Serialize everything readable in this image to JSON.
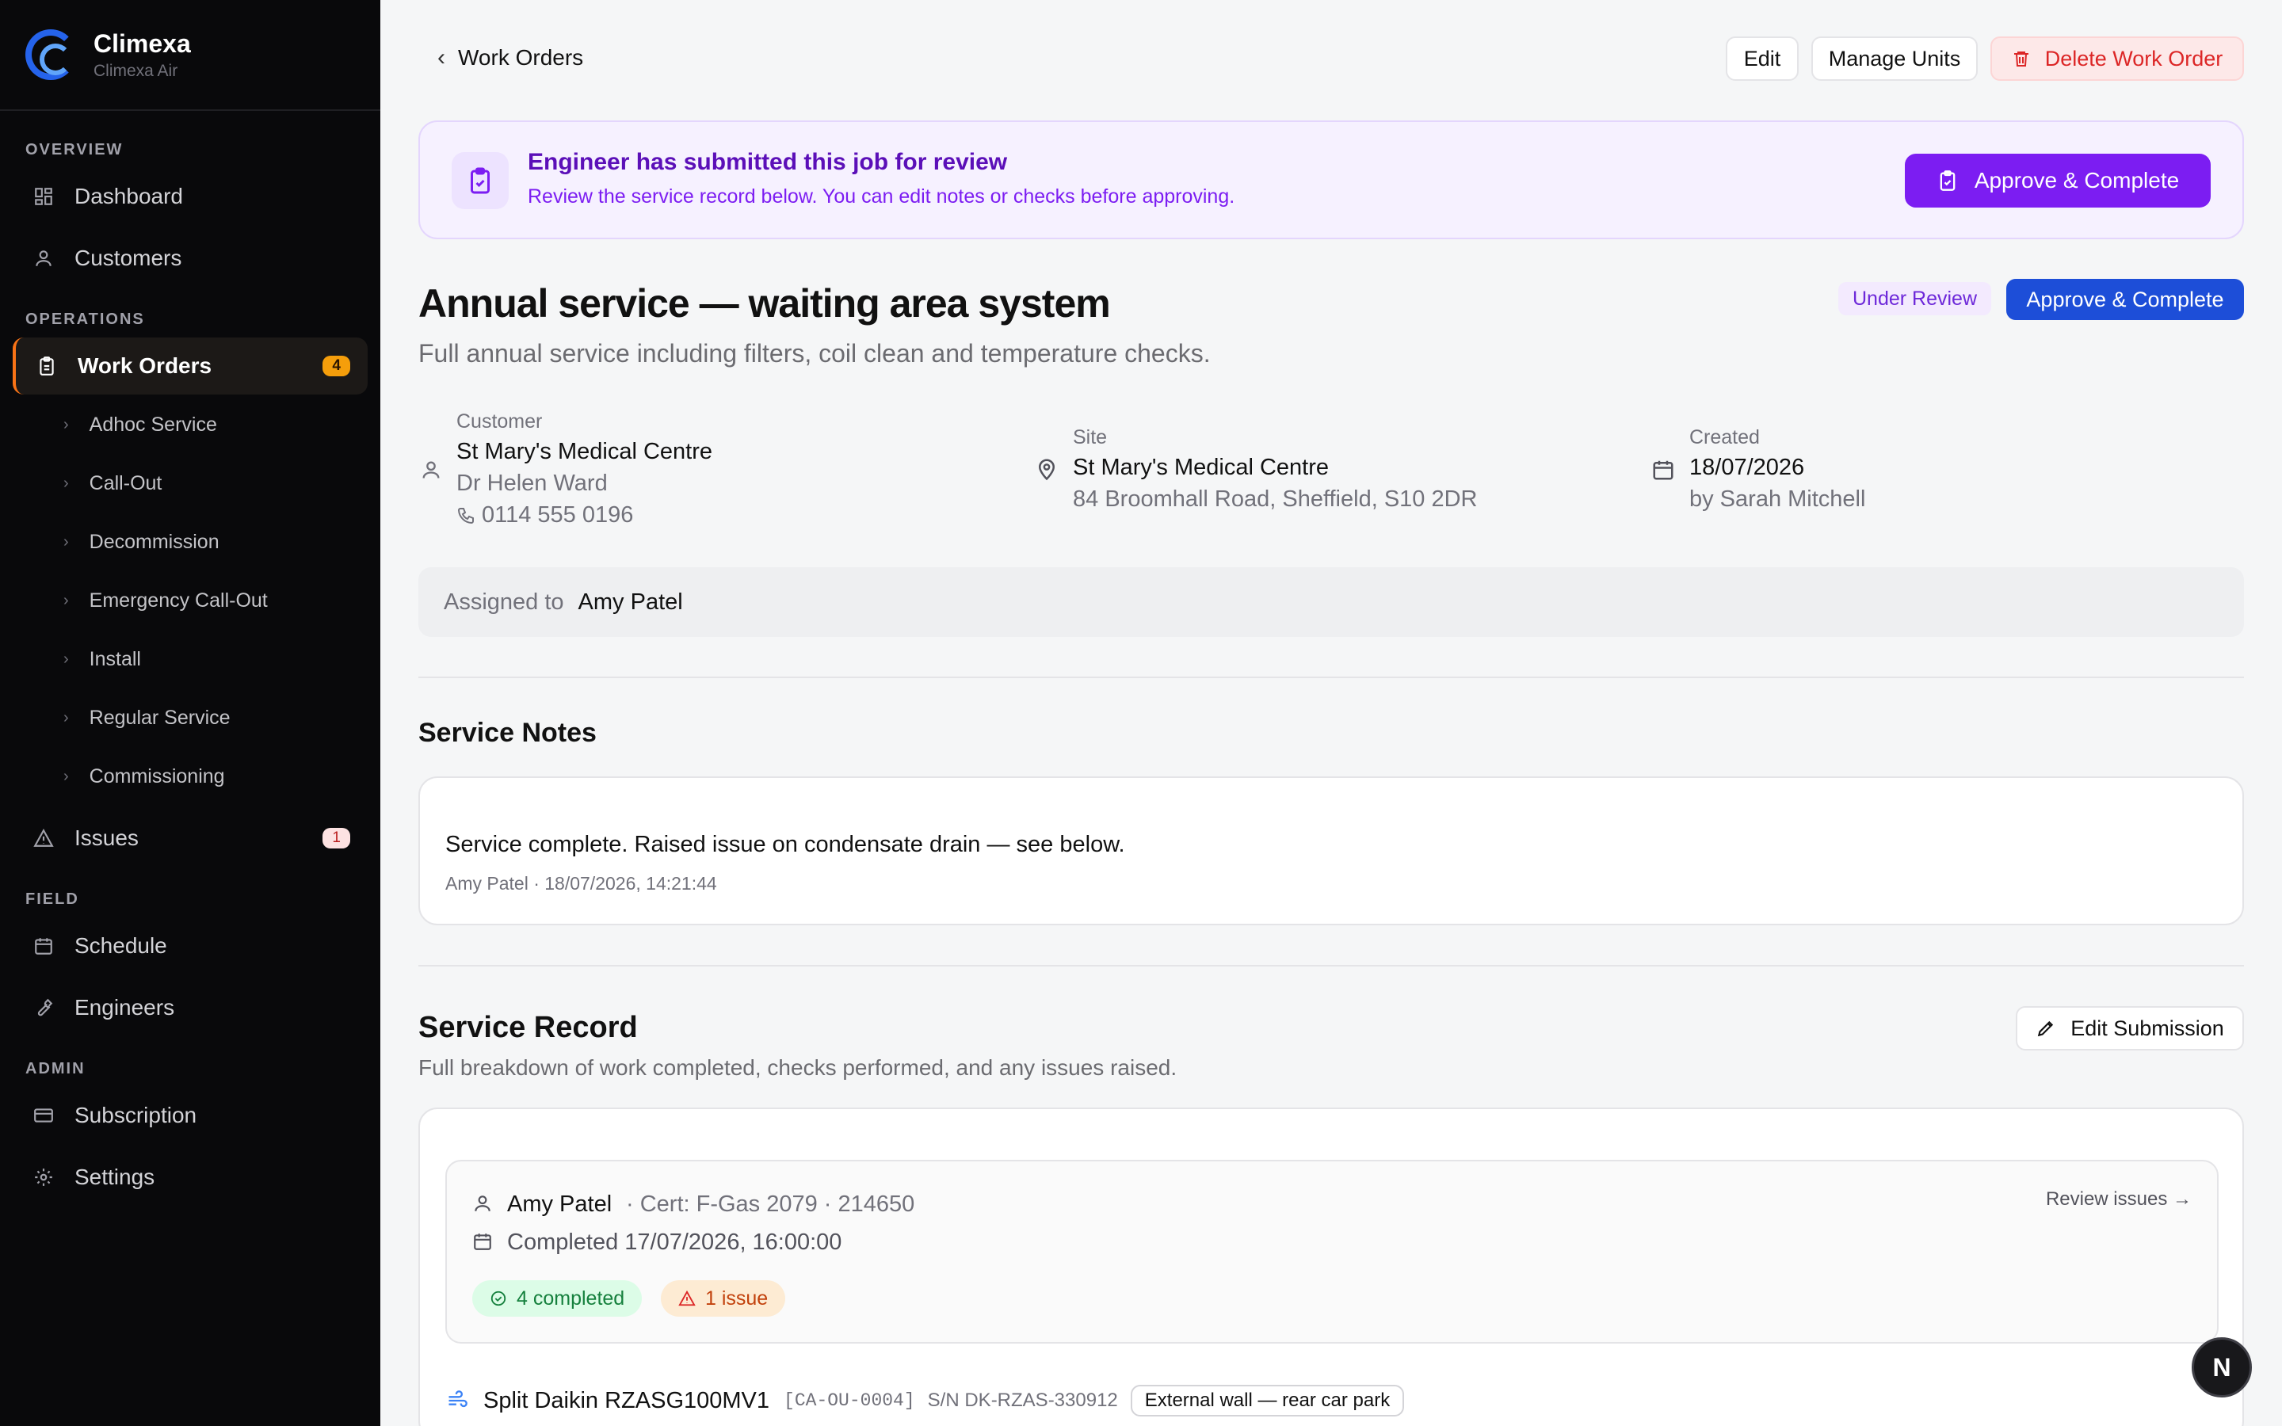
{
  "brand": {
    "name": "Climexa",
    "sub": "Climexa Air"
  },
  "sidebar": {
    "sections": {
      "overview": "OVERVIEW",
      "operations": "OPERATIONS",
      "field": "FIELD",
      "admin": "ADMIN"
    },
    "dashboard": "Dashboard",
    "customers": "Customers",
    "work_orders": "Work Orders",
    "work_orders_count": "4",
    "sub_items": [
      "Adhoc Service",
      "Call-Out",
      "Decommission",
      "Emergency Call-Out",
      "Install",
      "Regular Service",
      "Commissioning"
    ],
    "issues": "Issues",
    "issues_count": "1",
    "schedule": "Schedule",
    "engineers": "Engineers",
    "subscription": "Subscription",
    "settings": "Settings"
  },
  "header": {
    "back_label": "Work Orders",
    "edit": "Edit",
    "manage_units": "Manage Units",
    "delete": "Delete Work Order"
  },
  "banner": {
    "title": "Engineer has submitted this job for review",
    "subtitle": "Review the service record below. You can edit notes or checks before approving.",
    "button": "Approve & Complete"
  },
  "job": {
    "title": "Annual service — waiting area system",
    "description": "Full annual service including filters, coil clean and temperature checks.",
    "status": "Under Review",
    "approve": "Approve & Complete"
  },
  "customer": {
    "label": "Customer",
    "name": "St Mary's Medical Centre",
    "contact": "Dr Helen Ward",
    "phone": "0114 555 0196"
  },
  "site": {
    "label": "Site",
    "name": "St Mary's Medical Centre",
    "address": "84 Broomhall Road, Sheffield, S10 2DR"
  },
  "created": {
    "label": "Created",
    "date": "18/07/2026",
    "by": "by Sarah Mitchell"
  },
  "assigned": {
    "label": "Assigned to",
    "name": "Amy Patel"
  },
  "notes": {
    "heading": "Service Notes",
    "text": "Service complete. Raised issue on condensate drain — see below.",
    "meta": "Amy Patel · 18/07/2026, 14:21:44"
  },
  "record": {
    "heading": "Service Record",
    "subtitle": "Full breakdown of work completed, checks performed, and any issues raised.",
    "edit_button": "Edit Submission",
    "engineer": "Amy Patel",
    "cert": "· Cert: F-Gas 2079 · 214650",
    "completed": "Completed 17/07/2026, 16:00:00",
    "review_link": "Review issues →",
    "completed_pill": "4 completed",
    "issue_pill": "1 issue",
    "unit_name": "Split Daikin RZASG100MV1",
    "unit_code": "[CA-OU-0004]",
    "unit_serial": "S/N DK-RZAS-330912",
    "unit_location": "External wall — rear car park"
  },
  "fab": "N"
}
